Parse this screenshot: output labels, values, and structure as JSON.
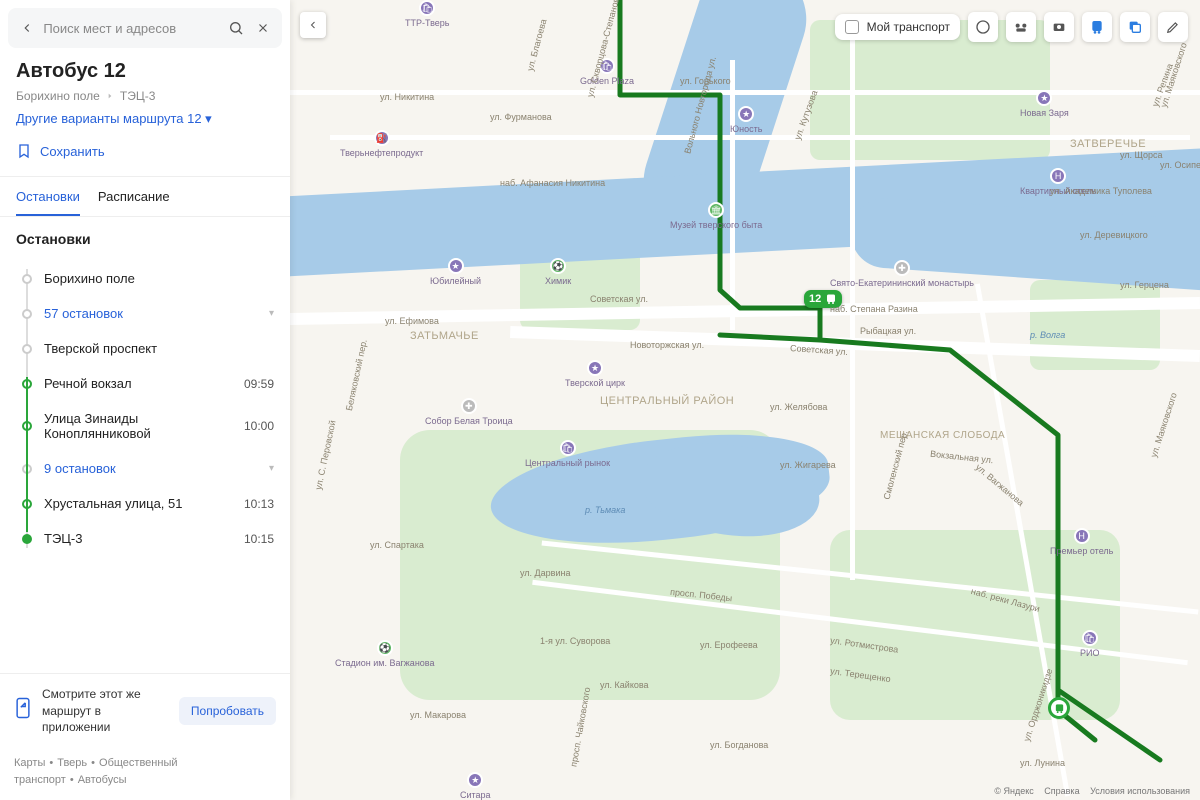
{
  "search": {
    "placeholder": "Поиск мест и адресов"
  },
  "route": {
    "title": "Автобус 12",
    "from": "Борихино поле",
    "to": "ТЭЦ-3",
    "variants_link": "Другие варианты маршрута 12",
    "save_label": "Сохранить"
  },
  "tabs": {
    "stops": "Остановки",
    "schedule": "Расписание"
  },
  "stops_heading": "Остановки",
  "stops": [
    {
      "name": "Борихино поле",
      "time": "",
      "kind": "normal"
    },
    {
      "name": "57 остановок",
      "time": "",
      "kind": "collapse"
    },
    {
      "name": "Тверской проспект",
      "time": "",
      "kind": "normal"
    },
    {
      "name": "Речной вокзал",
      "time": "09:59",
      "kind": "active"
    },
    {
      "name": "Улица Зинаиды Коноплянниковой",
      "time": "10:00",
      "kind": "active"
    },
    {
      "name": "9 остановок",
      "time": "",
      "kind": "collapse"
    },
    {
      "name": "Хрустальная улица, 51",
      "time": "10:13",
      "kind": "active"
    },
    {
      "name": "ТЭЦ-3",
      "time": "10:15",
      "kind": "terminal"
    }
  ],
  "promo": {
    "text": "Смотрите этот же маршрут в приложении",
    "button": "Попробовать"
  },
  "crumbs": [
    "Карты",
    "Тверь",
    "Общественный транспорт",
    "Автобусы"
  ],
  "transport_chip": "Мой транспорт",
  "route_badge": "12",
  "district_center": "ЦЕНТРАЛЬНЫЙ РАЙОН",
  "district_zatmache": "ЗАТЬМАЧЬЕ",
  "district_zatvereche": "ЗАТВЕРЕЧЬЕ",
  "district_sloboda": "МЕЩАНСКАЯ СЛОБОДА",
  "river_label": "р. Волга",
  "poi": {
    "circus": "Тверской цирк",
    "market": "Центральный рынок",
    "chimik": "Химик",
    "golden_plaza": "Golden Plaza",
    "ttr": "ТТР-Тверь",
    "yubil": "Юбилейный",
    "neft": "Тверьнефтепродукт",
    "museum": "Музей тверского быта",
    "sobor": "Собор Белая Троица",
    "stadium": "Стадион им. Вагжанова",
    "unost": "Юность",
    "monastery": "Свято-Екатерининский монастырь",
    "kvartir": "Квартирный отель",
    "premier": "Премьер отель",
    "rio": "РИО",
    "zarya": "Новая Заря",
    "sitara": "Ситара"
  },
  "streets": {
    "nikitina_emb": "наб. Афанасия Никитина",
    "sovetskaya": "Советская ул.",
    "novotorzh": "Новоторжская ул.",
    "furmanova": "ул. Фурманова",
    "nikitina": "ул. Никитина",
    "gorkogo": "ул. Горького",
    "razina": "наб. Степана Разина",
    "rybatskaya": "Рыбацкая ул.",
    "zhelyabova": "ул. Желябова",
    "zhigareva": "ул. Жигарева",
    "spartaka": "ул. Спартака",
    "darvina": "ул. Дарвина",
    "pobedy": "просп. Победы",
    "suvorova": "1-я ул. Суворова",
    "erofeeva": "ул. Ерофеева",
    "kaikova": "ул. Кайкова",
    "makarova": "ул. Макарова",
    "bogdanova": "ул. Богданова",
    "chaikovskogo": "просп. Чайковского",
    "efimova": "ул. Ефимова",
    "vokzalnaya": "Вокзальная ул.",
    "tupoleva": "ул. Академика Туполева",
    "shorsa": "ул. Щорса",
    "repina": "ул. Репина",
    "osipenko": "ул. Осипенко",
    "gercena": "ул. Герцена",
    "derevickogo": "ул. Деревицкого",
    "kutuzova": "ул. Кутузова",
    "volnogo": "Вольного Новгорода ул.",
    "blagoeva": "ул. Благоева",
    "skvorcova": "ул. Скворцова-Степанова",
    "smolenski": "Смоленский пер.",
    "rotmistrova": "ул. Ротмистрова",
    "treshenkova": "ул. Терещенко",
    "naklazuri": "наб. реки Лазури",
    "lunina": "ул. Лунина",
    "ordjonikidze": "ул. Орджоникидзе",
    "vagzhanova": "ул. Вагжанова",
    "mayakovskogo": "ул. Маяковского",
    "tmaka": "р. Тьмака",
    "belyakovski": "Беляковский пер.",
    "sofii": "ул. С. Перовской"
  },
  "copyright": {
    "brand": "© Яндекс",
    "help": "Справка",
    "terms": "Условия использования"
  }
}
